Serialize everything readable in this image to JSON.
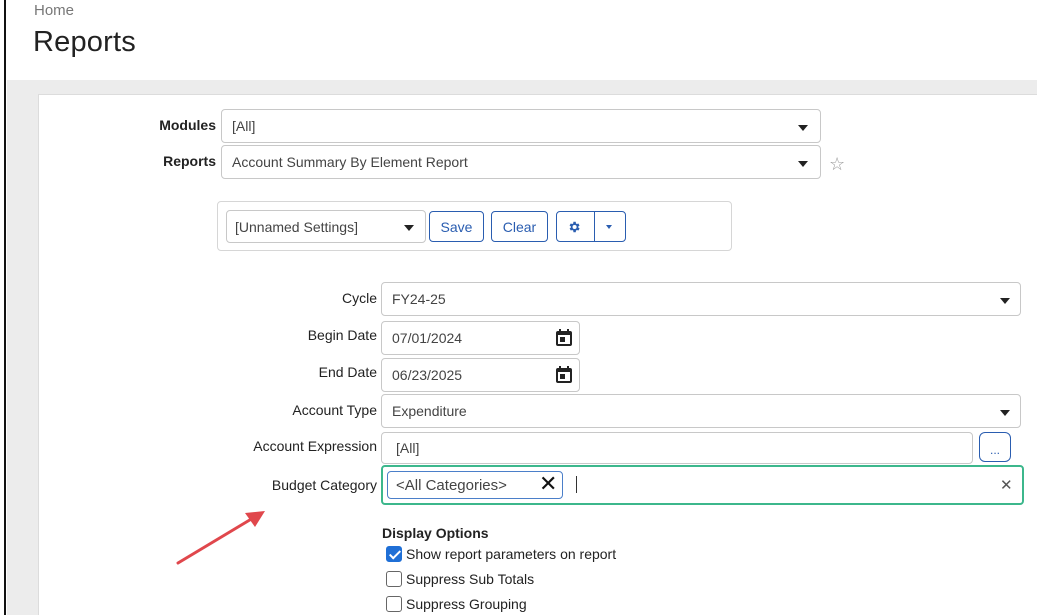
{
  "header": {
    "breadcrumb": "Home",
    "title": "Reports"
  },
  "selectors": {
    "modules": {
      "label": "Modules",
      "value": "[All]"
    },
    "reports": {
      "label": "Reports",
      "value": "Account Summary By Element Report"
    }
  },
  "settings_bar": {
    "settings_value": "[Unnamed Settings]",
    "save_label": "Save",
    "clear_label": "Clear"
  },
  "params": {
    "cycle": {
      "label": "Cycle",
      "value": "FY24-25"
    },
    "begin_date": {
      "label": "Begin Date",
      "value": "07/01/2024"
    },
    "end_date": {
      "label": "End Date",
      "value": "06/23/2025"
    },
    "account_type": {
      "label": "Account Type",
      "value": "Expenditure"
    },
    "account_expression": {
      "label": "Account Expression",
      "value": "[All]",
      "more_label": "..."
    },
    "budget_category": {
      "label": "Budget Category",
      "chip": "<All Categories>"
    }
  },
  "display_options": {
    "title": "Display Options",
    "items": [
      {
        "label": "Show report parameters on report",
        "checked": true
      },
      {
        "label": "Suppress Sub Totals",
        "checked": false
      },
      {
        "label": "Suppress Grouping",
        "checked": false
      }
    ]
  },
  "colors": {
    "accent": "#2a5db0",
    "focus_border": "#3cb78c",
    "checkbox_on": "#1f6fd6",
    "arrow": "#e0474c"
  }
}
